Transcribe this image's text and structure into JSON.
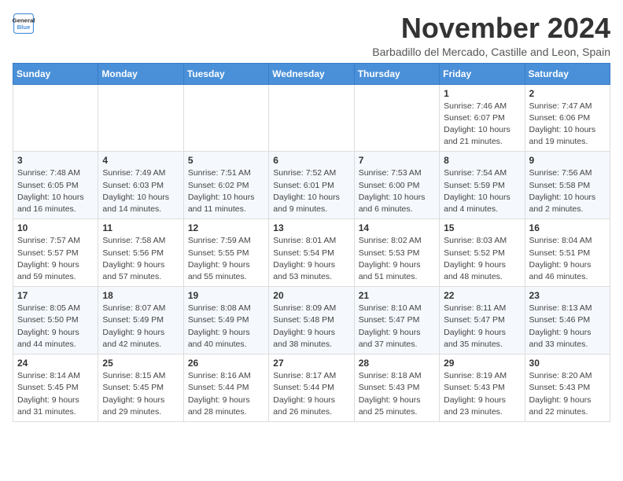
{
  "logo": {
    "line1": "General",
    "line2": "Blue"
  },
  "title": "November 2024",
  "subtitle": "Barbadillo del Mercado, Castille and Leon, Spain",
  "weekdays": [
    "Sunday",
    "Monday",
    "Tuesday",
    "Wednesday",
    "Thursday",
    "Friday",
    "Saturday"
  ],
  "weeks": [
    [
      {
        "day": "",
        "info": ""
      },
      {
        "day": "",
        "info": ""
      },
      {
        "day": "",
        "info": ""
      },
      {
        "day": "",
        "info": ""
      },
      {
        "day": "",
        "info": ""
      },
      {
        "day": "1",
        "info": "Sunrise: 7:46 AM\nSunset: 6:07 PM\nDaylight: 10 hours and 21 minutes."
      },
      {
        "day": "2",
        "info": "Sunrise: 7:47 AM\nSunset: 6:06 PM\nDaylight: 10 hours and 19 minutes."
      }
    ],
    [
      {
        "day": "3",
        "info": "Sunrise: 7:48 AM\nSunset: 6:05 PM\nDaylight: 10 hours and 16 minutes."
      },
      {
        "day": "4",
        "info": "Sunrise: 7:49 AM\nSunset: 6:03 PM\nDaylight: 10 hours and 14 minutes."
      },
      {
        "day": "5",
        "info": "Sunrise: 7:51 AM\nSunset: 6:02 PM\nDaylight: 10 hours and 11 minutes."
      },
      {
        "day": "6",
        "info": "Sunrise: 7:52 AM\nSunset: 6:01 PM\nDaylight: 10 hours and 9 minutes."
      },
      {
        "day": "7",
        "info": "Sunrise: 7:53 AM\nSunset: 6:00 PM\nDaylight: 10 hours and 6 minutes."
      },
      {
        "day": "8",
        "info": "Sunrise: 7:54 AM\nSunset: 5:59 PM\nDaylight: 10 hours and 4 minutes."
      },
      {
        "day": "9",
        "info": "Sunrise: 7:56 AM\nSunset: 5:58 PM\nDaylight: 10 hours and 2 minutes."
      }
    ],
    [
      {
        "day": "10",
        "info": "Sunrise: 7:57 AM\nSunset: 5:57 PM\nDaylight: 9 hours and 59 minutes."
      },
      {
        "day": "11",
        "info": "Sunrise: 7:58 AM\nSunset: 5:56 PM\nDaylight: 9 hours and 57 minutes."
      },
      {
        "day": "12",
        "info": "Sunrise: 7:59 AM\nSunset: 5:55 PM\nDaylight: 9 hours and 55 minutes."
      },
      {
        "day": "13",
        "info": "Sunrise: 8:01 AM\nSunset: 5:54 PM\nDaylight: 9 hours and 53 minutes."
      },
      {
        "day": "14",
        "info": "Sunrise: 8:02 AM\nSunset: 5:53 PM\nDaylight: 9 hours and 51 minutes."
      },
      {
        "day": "15",
        "info": "Sunrise: 8:03 AM\nSunset: 5:52 PM\nDaylight: 9 hours and 48 minutes."
      },
      {
        "day": "16",
        "info": "Sunrise: 8:04 AM\nSunset: 5:51 PM\nDaylight: 9 hours and 46 minutes."
      }
    ],
    [
      {
        "day": "17",
        "info": "Sunrise: 8:05 AM\nSunset: 5:50 PM\nDaylight: 9 hours and 44 minutes."
      },
      {
        "day": "18",
        "info": "Sunrise: 8:07 AM\nSunset: 5:49 PM\nDaylight: 9 hours and 42 minutes."
      },
      {
        "day": "19",
        "info": "Sunrise: 8:08 AM\nSunset: 5:49 PM\nDaylight: 9 hours and 40 minutes."
      },
      {
        "day": "20",
        "info": "Sunrise: 8:09 AM\nSunset: 5:48 PM\nDaylight: 9 hours and 38 minutes."
      },
      {
        "day": "21",
        "info": "Sunrise: 8:10 AM\nSunset: 5:47 PM\nDaylight: 9 hours and 37 minutes."
      },
      {
        "day": "22",
        "info": "Sunrise: 8:11 AM\nSunset: 5:47 PM\nDaylight: 9 hours and 35 minutes."
      },
      {
        "day": "23",
        "info": "Sunrise: 8:13 AM\nSunset: 5:46 PM\nDaylight: 9 hours and 33 minutes."
      }
    ],
    [
      {
        "day": "24",
        "info": "Sunrise: 8:14 AM\nSunset: 5:45 PM\nDaylight: 9 hours and 31 minutes."
      },
      {
        "day": "25",
        "info": "Sunrise: 8:15 AM\nSunset: 5:45 PM\nDaylight: 9 hours and 29 minutes."
      },
      {
        "day": "26",
        "info": "Sunrise: 8:16 AM\nSunset: 5:44 PM\nDaylight: 9 hours and 28 minutes."
      },
      {
        "day": "27",
        "info": "Sunrise: 8:17 AM\nSunset: 5:44 PM\nDaylight: 9 hours and 26 minutes."
      },
      {
        "day": "28",
        "info": "Sunrise: 8:18 AM\nSunset: 5:43 PM\nDaylight: 9 hours and 25 minutes."
      },
      {
        "day": "29",
        "info": "Sunrise: 8:19 AM\nSunset: 5:43 PM\nDaylight: 9 hours and 23 minutes."
      },
      {
        "day": "30",
        "info": "Sunrise: 8:20 AM\nSunset: 5:43 PM\nDaylight: 9 hours and 22 minutes."
      }
    ]
  ]
}
